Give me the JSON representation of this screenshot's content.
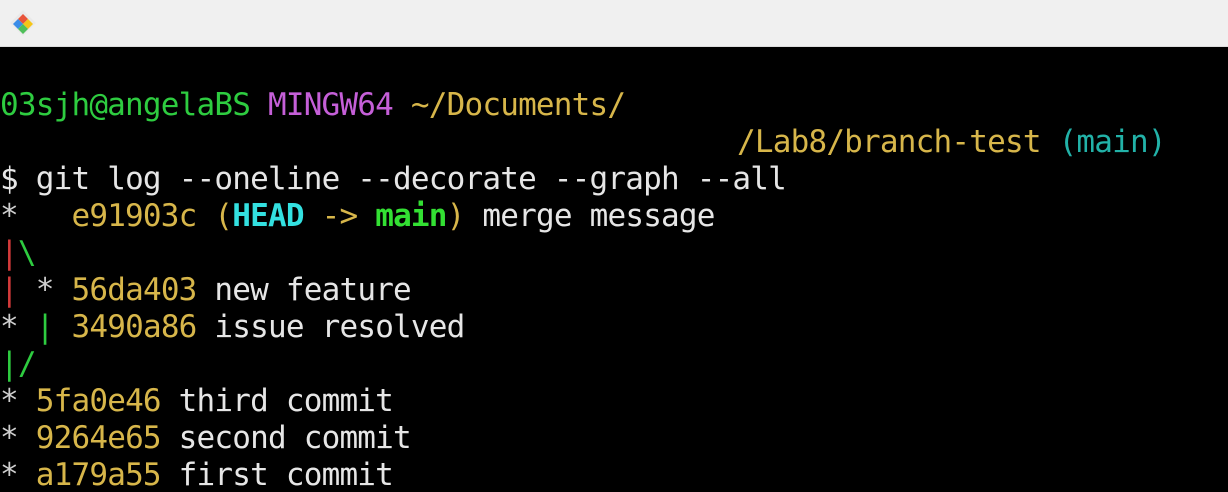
{
  "window": {
    "app_icon": "git-bash-icon"
  },
  "colors": {
    "terminal_bg": "#000000",
    "titlebar_bg": "#f0f0f0",
    "user_host": "#2ecc40",
    "msystem": "#c55fd8",
    "path": "#d7b64a",
    "branch": "#22b2a8",
    "hash": "#d7b64a",
    "head_ref": "#33e0e0",
    "main_ref": "#33e033",
    "graph_red": "#d23a3a",
    "graph_green": "#2ecc40"
  },
  "prompt": {
    "user_host": "03sjh@angelaBS",
    "msystem": "MINGW64",
    "path_line1": "~/Documents/",
    "path_line2": "/Lab8/branch-test",
    "branch": "(main)",
    "symbol": "$",
    "command": "git log --oneline --decorate --graph --all"
  },
  "log": {
    "merge": {
      "graph": "*  ",
      "hash": "e91903c",
      "open_paren": "(",
      "head": "HEAD",
      "arrow": " -> ",
      "branch": "main",
      "close_paren": ")",
      "message": "merge message"
    },
    "branch_split": {
      "left": "|",
      "right": "\\"
    },
    "feature": {
      "left_bar": "|",
      "star": "*",
      "hash": "56da403",
      "message": "new feature"
    },
    "issue": {
      "star": "*",
      "right_bar": "|",
      "hash": "3490a86",
      "message": "issue resolved"
    },
    "branch_join": {
      "left": "|",
      "right": "/"
    },
    "commits": [
      {
        "graph": "*",
        "hash": "5fa0e46",
        "message": "third commit"
      },
      {
        "graph": "*",
        "hash": "9264e65",
        "message": "second commit"
      },
      {
        "graph": "*",
        "hash": "a179a55",
        "message": "first commit"
      }
    ]
  }
}
